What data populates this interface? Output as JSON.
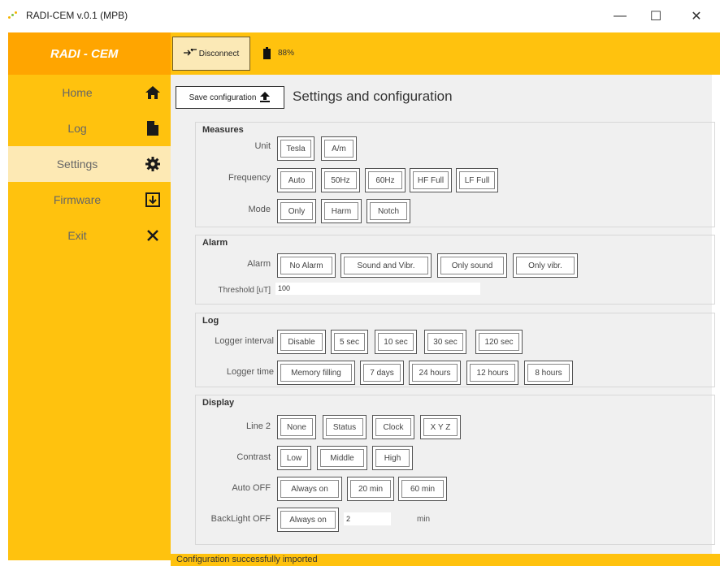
{
  "window": {
    "title": "RADI-CEM v.0.1 (MPB)",
    "minimize": "—",
    "maximize": "☐",
    "close": "✕"
  },
  "sidebar": {
    "brand": "RADI - CEM",
    "items": [
      {
        "label": "Home",
        "icon": "home-icon"
      },
      {
        "label": "Log",
        "icon": "file-icon"
      },
      {
        "label": "Settings",
        "icon": "gear-icon"
      },
      {
        "label": "Firmware",
        "icon": "download-icon"
      },
      {
        "label": "Exit",
        "icon": "close-icon"
      }
    ]
  },
  "topbar": {
    "disconnect_label": "Disconnect",
    "battery_level": "88%"
  },
  "main": {
    "save_label": "Save configuration",
    "title": "Settings and configuration"
  },
  "measures": {
    "title": "Measures",
    "unit_label": "Unit",
    "unit_options": [
      "Tesla",
      "A/m"
    ],
    "frequency_label": "Frequency",
    "frequency_options": [
      "Auto",
      "50Hz",
      "60Hz",
      "HF Full",
      "LF Full"
    ],
    "mode_label": "Mode",
    "mode_options": [
      "Only",
      "Harm",
      "Notch"
    ]
  },
  "alarm": {
    "title": "Alarm",
    "alarm_label": "Alarm",
    "alarm_options": [
      "No Alarm",
      "Sound and Vibr.",
      "Only sound",
      "Only vibr."
    ],
    "threshold_label": "Threshold [uT]",
    "threshold_value": "100"
  },
  "log": {
    "title": "Log",
    "interval_label": "Logger interval",
    "interval_options": [
      "Disable",
      "5 sec",
      "10 sec",
      "30 sec",
      "120 sec"
    ],
    "time_label": "Logger time",
    "time_options": [
      "Memory filling",
      "7 days",
      "24 hours",
      "12 hours",
      "8 hours"
    ]
  },
  "display": {
    "title": "Display",
    "line2_label": "Line 2",
    "line2_options": [
      "None",
      "Status",
      "Clock",
      "X Y Z"
    ],
    "contrast_label": "Contrast",
    "contrast_options": [
      "Low",
      "Middle",
      "High"
    ],
    "autooff_label": "Auto OFF",
    "autooff_options": [
      "Always on",
      "20 min",
      "60 min"
    ],
    "backlight_label": "BackLight OFF",
    "backlight_option": "Always on",
    "backlight_value": "2",
    "backlight_unit": "min"
  },
  "status": {
    "message": "Configuration successfully imported"
  },
  "colors": {
    "accent": "#ffc20e",
    "brand_bg": "#ffa500",
    "active_item": "#fde9b4",
    "content_bg": "#f0f0f0"
  }
}
